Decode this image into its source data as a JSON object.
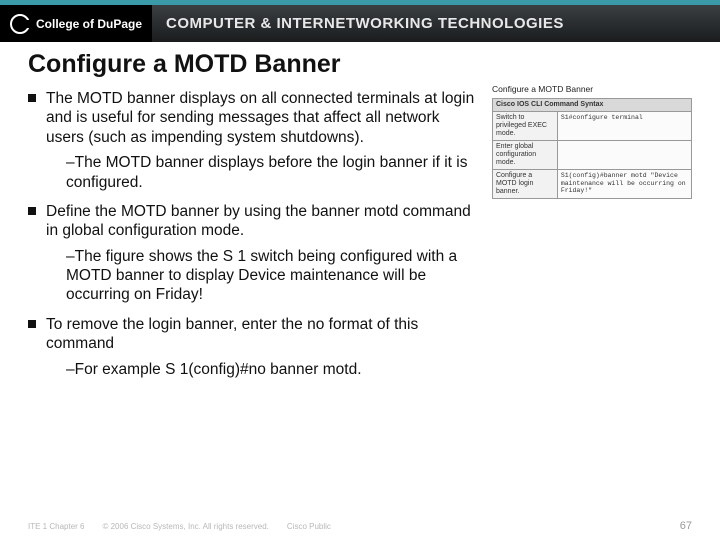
{
  "header": {
    "logo_text": "College of DuPage",
    "title": "COMPUTER & INTERNETWORKING TECHNOLOGIES"
  },
  "slide": {
    "title": "Configure a MOTD Banner",
    "bullets": [
      {
        "text": "The MOTD banner displays on all connected terminals at login and is useful for sending messages that affect all network users (such as impending system shutdowns).",
        "sub": "–The MOTD banner displays before the login banner if it is configured."
      },
      {
        "text": "Define the MOTD banner by using the banner motd command in global configuration mode.",
        "sub": "–The figure shows the S 1 switch being configured with a MOTD banner to display Device maintenance will be occurring on Friday!"
      },
      {
        "text": "To remove the login banner, enter the no format of this command",
        "sub": "–For example S 1(config)#no banner motd."
      }
    ]
  },
  "figure": {
    "title": "Configure a MOTD Banner",
    "header_left": "Cisco IOS CLI Command Syntax",
    "rows": [
      {
        "left": "Switch to privileged EXEC mode.",
        "right": "S1#configure terminal"
      },
      {
        "left": "Enter global configuration mode.",
        "right": ""
      },
      {
        "left": "Configure a MOTD login banner.",
        "right": "S1(config)#banner motd \"Device maintenance will be occurring on Friday!\""
      }
    ]
  },
  "footer": {
    "chapter": "ITE 1 Chapter 6",
    "copyright": "© 2006 Cisco Systems, Inc. All rights reserved.",
    "public": "Cisco Public",
    "page": "67"
  }
}
